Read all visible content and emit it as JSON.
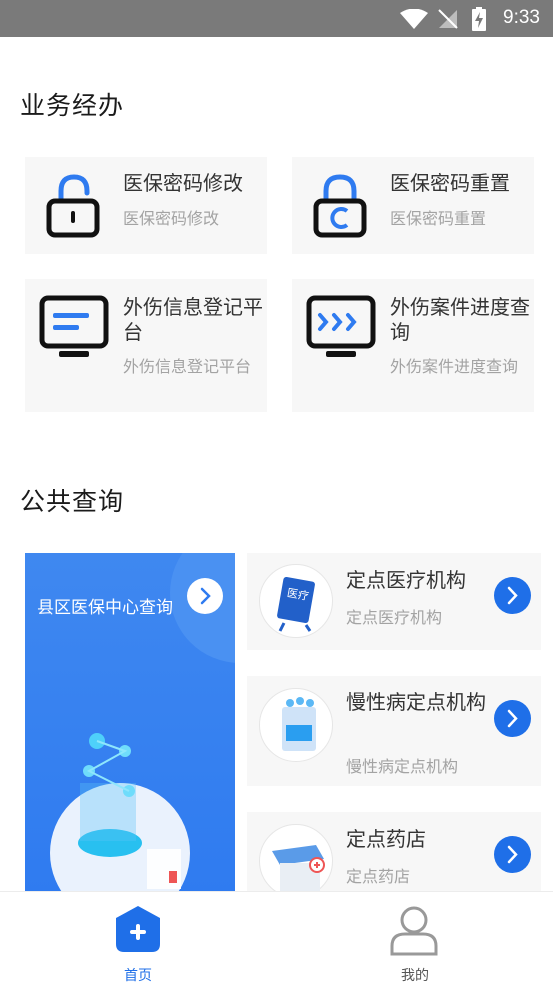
{
  "status_bar": {
    "time": "9:33"
  },
  "business": {
    "title": "业务经办",
    "cards": [
      {
        "title": "医保密码修改",
        "subtitle": "医保密码修改"
      },
      {
        "title": "医保密码重置",
        "subtitle": "医保密码重置"
      },
      {
        "title": "外伤信息登记平台",
        "subtitle": "外伤信息登记平台"
      },
      {
        "title": "外伤案件进度查询",
        "subtitle": "外伤案件进度查询"
      }
    ]
  },
  "public_query": {
    "title": "公共查询",
    "banner": {
      "title": "县区医保中心查询"
    },
    "items": [
      {
        "title": "定点医疗机构",
        "subtitle": "定点医疗机构",
        "icon_text": "医疗"
      },
      {
        "title": "慢性病定点机构",
        "subtitle": "慢性病定点机构"
      },
      {
        "title": "定点药店",
        "subtitle": "定点药店"
      }
    ]
  },
  "tabbar": {
    "tabs": [
      {
        "label": "首页",
        "active": true
      },
      {
        "label": "我的",
        "active": false
      }
    ]
  },
  "colors": {
    "accent": "#1f6fe8",
    "banner": "#3585f0",
    "card_bg": "#f7f7f7",
    "muted_text": "#a3a3a3"
  }
}
